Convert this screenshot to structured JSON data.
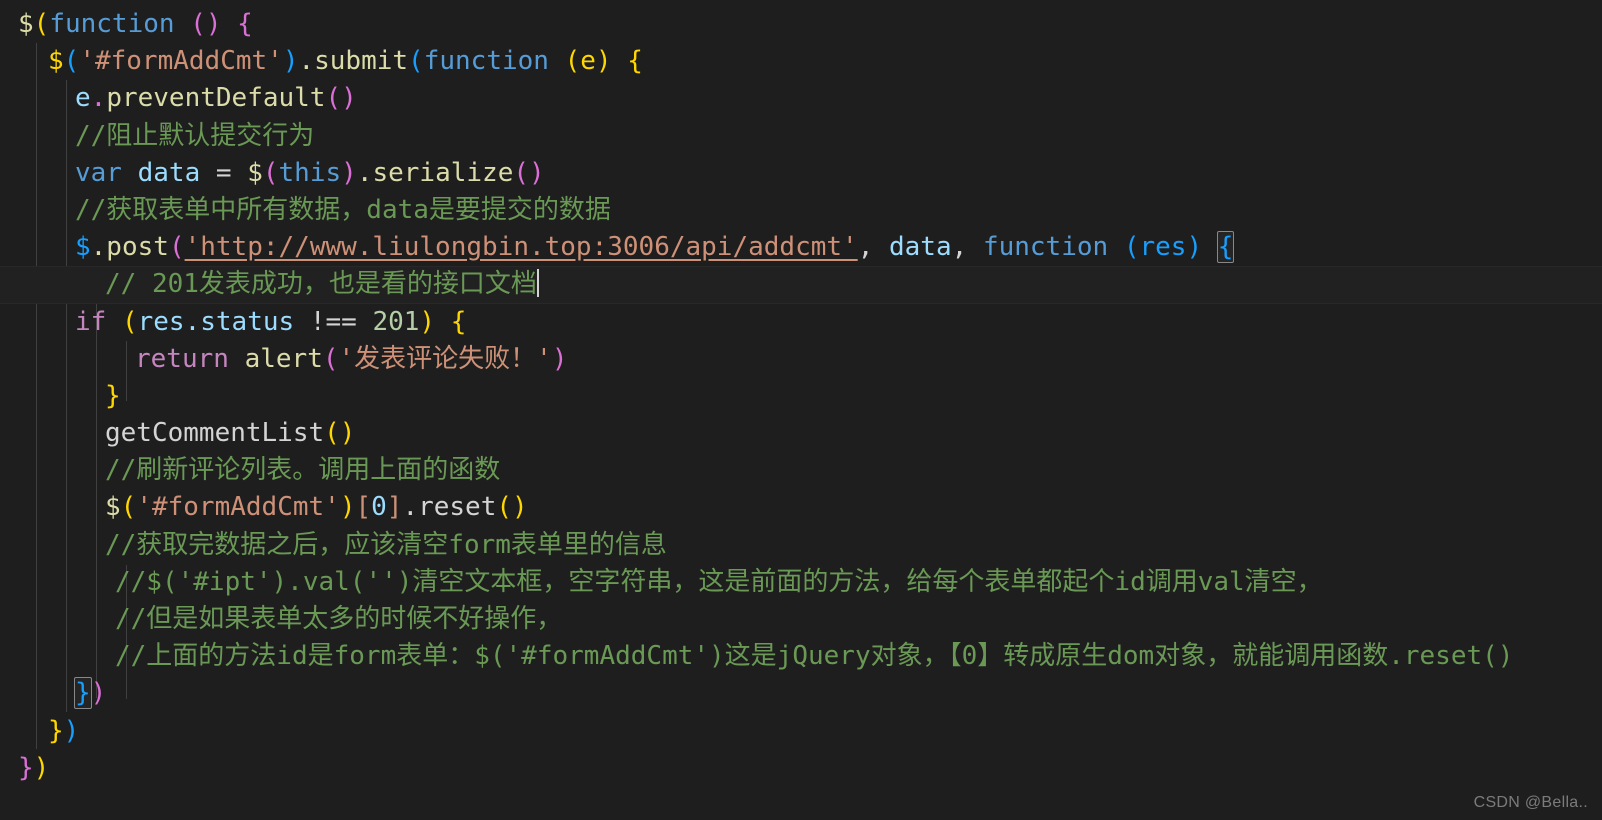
{
  "editor": {
    "theme_name": "dark-plus",
    "background": "#1e1e1e",
    "font_size_px": 26,
    "language": "javascript",
    "colors": {
      "comment": "#6a9955",
      "string": "#ce9178",
      "keyword": "#c586c0",
      "keyword_blue": "#569cd6",
      "variable": "#9cdcfe",
      "function": "#dcdcaa",
      "number": "#b5cea8",
      "bracket_level_1": "#ffd700",
      "bracket_level_2": "#da70d6",
      "bracket_level_3": "#179fff",
      "indent_guide": "#404040",
      "current_line_border": "#282828",
      "watermark": "#8c8c8c"
    }
  },
  "code": {
    "line_01": {
      "dollar": "$",
      "paren_open": "(",
      "function_kw": "function",
      "empty_parens": "()",
      "brace_open": "{"
    },
    "line_02": {
      "dollar": "$",
      "paren_open": "(",
      "selector": "'#formAddCmt'",
      "paren_close": ")",
      "dot_submit": ".submit",
      "paren_open2": "(",
      "function_kw": "function",
      "params": "(e)",
      "brace_open": "{"
    },
    "line_03": {
      "obj": "e",
      "dot": ".",
      "method": "preventDefault",
      "parens": "()"
    },
    "line_04": {
      "comment": "//阻止默认提交行为"
    },
    "line_05": {
      "var_kw": "var",
      "name": "data",
      "eq": "=",
      "dollar": "$",
      "paren_open": "(",
      "this_kw": "this",
      "paren_close": ")",
      "dot_method": ".serialize",
      "parens": "()"
    },
    "line_06": {
      "comment": "//获取表单中所有数据，data是要提交的数据"
    },
    "line_07": {
      "dollar": "$",
      "dot_post": ".post",
      "paren_open": "(",
      "url_string": "'http://www.liulongbin.top:3006/api/addcmt'",
      "comma1": ", ",
      "data_arg": "data",
      "comma2": ", ",
      "function_kw": "function",
      "params": "(res)",
      "brace_open": "{"
    },
    "line_08": {
      "comment": "// 201发表成功，也是看的接口文档",
      "is_current_line": true,
      "has_caret": true
    },
    "line_09": {
      "if_kw": "if",
      "paren_open": "(",
      "obj": "res",
      "prop": ".status",
      "operator": "!==",
      "number": "201",
      "paren_close": ")",
      "brace_open": "{"
    },
    "line_10": {
      "return_kw": "return",
      "fn": "alert",
      "paren_open": "(",
      "string": "'发表评论失败！'",
      "paren_close": ")"
    },
    "line_11": {
      "brace_close": "}"
    },
    "line_12": {
      "fn_call": "getCommentList",
      "parens": "()"
    },
    "line_13": {
      "comment": "//刷新评论列表。调用上面的函数"
    },
    "line_14": {
      "dollar": "$",
      "paren_open": "(",
      "selector": "'#formAddCmt'",
      "paren_close": ")",
      "bracket_open": "[",
      "index": "0",
      "bracket_close": "]",
      "dot_reset": ".reset",
      "parens": "()"
    },
    "line_15": {
      "comment": "//获取完数据之后，应该清空form表单里的信息"
    },
    "line_16": {
      "comment": "//$('#ipt').val('')清空文本框，空字符串，这是前面的方法，给每个表单都起个id调用val清空，"
    },
    "line_17": {
      "comment": "//但是如果表单太多的时候不好操作，"
    },
    "line_18": {
      "comment": "//上面的方法id是form表单：$('#formAddCmt')这是jQuery对象，【0】转成原生dom对象，就能调用函数.reset()"
    },
    "line_19": {
      "brace_close": "}",
      "paren_close": ")",
      "bracket_matched": true
    },
    "line_20": {
      "brace_close": "}",
      "paren_close": ")"
    },
    "line_21": {
      "brace_close": "}",
      "paren_close": ")"
    }
  },
  "watermark": {
    "text": "CSDN @Bella.."
  }
}
